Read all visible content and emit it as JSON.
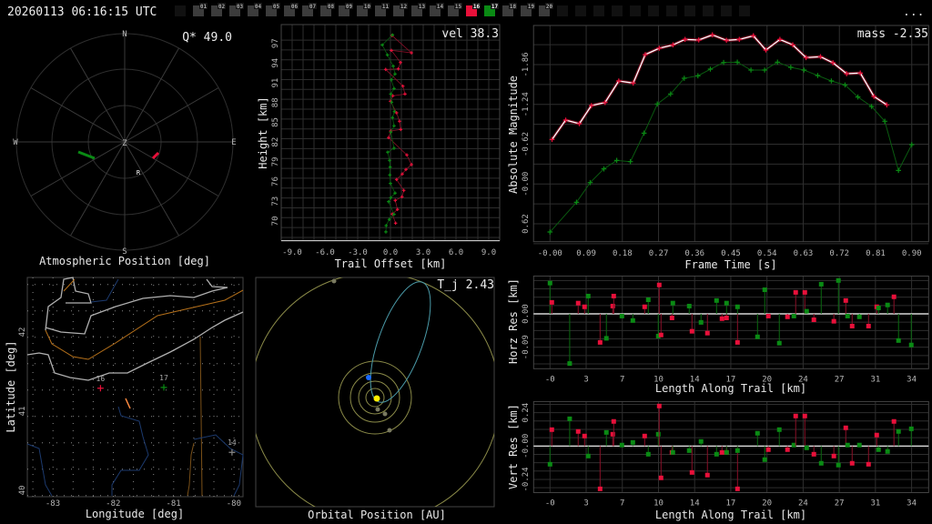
{
  "header": {
    "timestamp": "20260113 06:16:15 UTC",
    "menu_label": "...",
    "leading_empty_slots": 1,
    "trailing_empty_slots": 11,
    "stations": [
      {
        "label": "01",
        "state": "idle"
      },
      {
        "label": "02",
        "state": "idle"
      },
      {
        "label": "03",
        "state": "idle"
      },
      {
        "label": "04",
        "state": "idle"
      },
      {
        "label": "05",
        "state": "idle"
      },
      {
        "label": "06",
        "state": "idle"
      },
      {
        "label": "07",
        "state": "idle"
      },
      {
        "label": "08",
        "state": "idle"
      },
      {
        "label": "09",
        "state": "idle"
      },
      {
        "label": "10",
        "state": "idle"
      },
      {
        "label": "11",
        "state": "idle"
      },
      {
        "label": "12",
        "state": "idle"
      },
      {
        "label": "13",
        "state": "idle"
      },
      {
        "label": "14",
        "state": "idle"
      },
      {
        "label": "15",
        "state": "idle"
      },
      {
        "label": "16",
        "state": "red"
      },
      {
        "label": "17",
        "state": "green"
      },
      {
        "label": "18",
        "state": "idle"
      },
      {
        "label": "19",
        "state": "idle"
      },
      {
        "label": "20",
        "state": "idle"
      }
    ]
  },
  "colors": {
    "red": "#e8103a",
    "green": "#0a8a14",
    "idle": "#3c3c3c",
    "empty": "#111111",
    "bg": "#000000"
  },
  "polar": {
    "title": "Atmospheric Position [deg]",
    "stat": "Q* 49.0",
    "labels": {
      "n": "N",
      "s": "S",
      "e": "E",
      "w": "W",
      "z": "Z",
      "r": "R"
    }
  },
  "map": {
    "xlabel": "Longitude [deg]",
    "ylabel": "Latitude [deg]",
    "lon_ticks": [
      "-83",
      "-82",
      "-81",
      "-80"
    ],
    "lat_ticks": [
      "42",
      "41",
      "40"
    ],
    "stations": [
      {
        "label": "16",
        "lon": -82.21,
        "lat": 41.29,
        "color": "red"
      },
      {
        "label": "17",
        "lon": -81.16,
        "lat": 41.3,
        "color": "green"
      },
      {
        "label": "14",
        "lon": -80.03,
        "lat": 40.48,
        "color": "idle"
      }
    ]
  },
  "orbit": {
    "title": "Orbital Position [AU]",
    "stat": "T_j 2.43"
  },
  "chart_data": [
    {
      "type": "scatter",
      "name": "height-profile",
      "xlabel": "Trail Offset [km]",
      "ylabel": "Height [km]",
      "stat": "vel 38.3",
      "xlim": [
        -10,
        10
      ],
      "ylim": [
        67,
        100
      ],
      "xticks": [
        -9,
        -6,
        -3,
        0,
        3,
        6,
        9
      ],
      "xtick_labels": [
        "-9.0",
        "-6.0",
        "-3.0",
        "0.0",
        "3.0",
        "6.0",
        "9.0"
      ],
      "yticks": [
        70,
        73,
        76,
        79,
        82,
        85,
        88,
        91,
        94,
        97
      ],
      "ytick_labels": [
        "70",
        "73",
        "76",
        "79",
        "82",
        "85",
        "88",
        "91",
        "94",
        "97"
      ],
      "series": [
        {
          "name": "16",
          "color": "red",
          "x": [
            0.14,
            1.92,
            0.08,
            0.92,
            0.72,
            -0.44,
            1.14,
            1.33,
            0.22,
            0.0,
            0.56,
            0.83,
            0.94,
            0.03,
            -0.17,
            1.5,
            1.92,
            1.42,
            1.08,
            0.56,
            1.22,
            1.06,
            0.44,
            0.64,
            0.17,
            0.47
          ],
          "y": [
            98.2,
            95.57,
            95.94,
            94.1,
            93.13,
            93.04,
            90.5,
            89.3,
            89.03,
            88.2,
            86.45,
            85.16,
            83.91,
            83.68,
            82.67,
            80.04,
            78.57,
            77.83,
            77.14,
            76.31,
            74.65,
            73.68,
            73.13,
            71.75,
            71.06,
            69.67
          ]
        },
        {
          "name": "17",
          "color": "green",
          "x": [
            0.19,
            -0.75,
            -0.28,
            0.25,
            0.42,
            0.08,
            0.33,
            0.03,
            0.11,
            0.36,
            0.19,
            0.33,
            0.03,
            0.33,
            -0.25,
            -0.08,
            -0.03,
            -0.06,
            0.0,
            0.42,
            0.03,
            -0.17,
            0.33,
            -0.11,
            -0.39,
            -0.42
          ],
          "y": [
            98.29,
            96.77,
            95.25,
            93.54,
            92.35,
            91.47,
            90.13,
            89.3,
            88.06,
            86.63,
            85.71,
            84.47,
            83.5,
            81.06,
            80.46,
            79.21,
            78.2,
            77.0,
            75.71,
            74.24,
            73.54,
            72.94,
            71.01,
            70.23,
            69.3,
            68.34
          ]
        }
      ]
    },
    {
      "type": "line",
      "name": "light-curve",
      "xlabel": "Frame Time [s]",
      "ylabel": "Absolute Magnitude",
      "stat": "mass -2.35",
      "xlim": [
        -0.041,
        0.942
      ],
      "ylim": [
        -2.465,
        0.899
      ],
      "xticks": [
        0,
        0.09,
        0.18,
        0.27,
        0.36,
        0.45,
        0.54,
        0.63,
        0.72,
        0.81,
        0.9
      ],
      "xtick_labels": [
        "-0.00",
        "0.09",
        "0.18",
        "0.27",
        "0.36",
        "0.45",
        "0.54",
        "0.63",
        "0.72",
        "0.81",
        "0.90"
      ],
      "yticks": [
        -1.86,
        -1.24,
        -0.62,
        0,
        0.62
      ],
      "ytick_labels": [
        "-1.86",
        "-1.24",
        "-0.62",
        "-0.00",
        "0.62"
      ],
      "series": [
        {
          "name": "16",
          "color": "red",
          "x": [
            0.005,
            0.039,
            0.073,
            0.103,
            0.137,
            0.171,
            0.207,
            0.237,
            0.272,
            0.306,
            0.336,
            0.37,
            0.404,
            0.439,
            0.471,
            0.506,
            0.537,
            0.572,
            0.604,
            0.637,
            0.673,
            0.704,
            0.738,
            0.772,
            0.806,
            0.838
          ],
          "y": [
            -0.693,
            -0.995,
            -0.939,
            -1.222,
            -1.269,
            -1.605,
            -1.572,
            -2.016,
            -2.115,
            -2.167,
            -2.252,
            -2.243,
            -2.323,
            -2.238,
            -2.252,
            -2.309,
            -2.087,
            -2.252,
            -2.167,
            -1.969,
            -1.983,
            -1.888,
            -1.718,
            -1.728,
            -1.364,
            -1.232
          ]
        },
        {
          "name": "17",
          "color": "green",
          "x": [
            0.0,
            0.066,
            0.1,
            0.134,
            0.166,
            0.2,
            0.234,
            0.267,
            0.3,
            0.334,
            0.368,
            0.399,
            0.432,
            0.466,
            0.5,
            0.534,
            0.566,
            0.599,
            0.632,
            0.666,
            0.7,
            0.734,
            0.766,
            0.8,
            0.833,
            0.867,
            0.9
          ],
          "y": [
            0.748,
            0.285,
            -0.022,
            -0.235,
            -0.367,
            -0.348,
            -0.792,
            -1.246,
            -1.402,
            -1.647,
            -1.685,
            -1.789,
            -1.893,
            -1.898,
            -1.775,
            -1.775,
            -1.898,
            -1.817,
            -1.775,
            -1.69,
            -1.605,
            -1.543,
            -1.355,
            -1.208,
            -0.977,
            -0.211,
            -0.613
          ]
        }
      ]
    },
    {
      "type": "scatter",
      "name": "residuals",
      "xlabel": "Length Along Trail [km]",
      "horz_ylabel": "Horz Res [km]",
      "vert_ylabel": "Vert Res [km]",
      "xlim": [
        -1.54,
        35.6
      ],
      "horz_ylim": [
        -0.148,
        0.102
      ],
      "vert_ylim": [
        -0.335,
        0.32
      ],
      "xticks": [
        0,
        3.4,
        6.8,
        10.2,
        13.6,
        17,
        20.4,
        23.8,
        27.2,
        30.6,
        34
      ],
      "xtick_labels": [
        "-0",
        "3",
        "7",
        "10",
        "14",
        "17",
        "20",
        "24",
        "27",
        "31",
        "34"
      ],
      "horz_yticks": [
        0,
        -0.09
      ],
      "horz_ytick_labels": [
        "0.00",
        "-0.09"
      ],
      "vert_yticks": [
        0.24,
        0,
        -0.24
      ],
      "vert_ytick_labels": [
        "0.24",
        "-0.00",
        "-0.24"
      ],
      "points": [
        [
          "g",
          0.0,
          0.083,
          -0.131
        ],
        [
          "r",
          0.17,
          0.031,
          0.118
        ],
        [
          "g",
          1.85,
          -0.134,
          0.196
        ],
        [
          "r",
          2.65,
          0.029,
          0.105
        ],
        [
          "r",
          3.25,
          0.019,
          0.072
        ],
        [
          "g",
          3.59,
          0.048,
          -0.072
        ],
        [
          "r",
          4.71,
          -0.077,
          -0.308
        ],
        [
          "g",
          5.3,
          -0.066,
          0.098
        ],
        [
          "r",
          5.9,
          0.021,
          0.085
        ],
        [
          "r",
          5.99,
          0.048,
          0.177
        ],
        [
          "g",
          6.76,
          -0.006,
          0.007
        ],
        [
          "g",
          7.79,
          -0.018,
          0.026
        ],
        [
          "r",
          8.9,
          0.019,
          0.072
        ],
        [
          "g",
          9.24,
          0.038,
          -0.059
        ],
        [
          "g",
          10.18,
          -0.06,
          0.085
        ],
        [
          "r",
          10.27,
          0.078,
          0.288
        ],
        [
          "r",
          10.44,
          -0.057,
          -0.229
        ],
        [
          "r",
          11.47,
          -0.011,
          -0.046
        ],
        [
          "g",
          11.55,
          0.029,
          -0.046
        ],
        [
          "g",
          13.09,
          0.021,
          -0.033
        ],
        [
          "r",
          13.35,
          -0.047,
          -0.19
        ],
        [
          "g",
          14.2,
          -0.023,
          0.033
        ],
        [
          "r",
          14.8,
          -0.052,
          -0.209
        ],
        [
          "g",
          15.66,
          0.036,
          -0.059
        ],
        [
          "r",
          16.17,
          -0.013,
          -0.046
        ],
        [
          "r",
          16.6,
          -0.011,
          -0.046
        ],
        [
          "g",
          16.6,
          0.029,
          -0.046
        ],
        [
          "r",
          17.63,
          -0.077,
          -0.308
        ],
        [
          "g",
          17.63,
          0.019,
          -0.033
        ],
        [
          "g",
          19.51,
          -0.062,
          0.092
        ],
        [
          "g",
          20.19,
          0.065,
          -0.098
        ],
        [
          "r",
          20.53,
          -0.006,
          -0.026
        ],
        [
          "g",
          21.56,
          -0.079,
          0.118
        ],
        [
          "r",
          22.33,
          -0.008,
          -0.026
        ],
        [
          "g",
          22.93,
          -0.006,
          0.007
        ],
        [
          "r",
          23.1,
          0.058,
          0.216
        ],
        [
          "r",
          23.96,
          0.058,
          0.216
        ],
        [
          "g",
          24.13,
          0.007,
          -0.013
        ],
        [
          "r",
          24.81,
          -0.016,
          -0.059
        ],
        [
          "g",
          25.5,
          0.08,
          -0.124
        ],
        [
          "r",
          26.69,
          -0.02,
          -0.072
        ],
        [
          "g",
          27.12,
          0.09,
          -0.137
        ],
        [
          "r",
          27.81,
          0.036,
          0.131
        ],
        [
          "g",
          27.98,
          -0.006,
          0.007
        ],
        [
          "r",
          28.41,
          -0.033,
          -0.124
        ],
        [
          "g",
          29.09,
          -0.008,
          0.007
        ],
        [
          "r",
          29.95,
          -0.033,
          -0.131
        ],
        [
          "r",
          30.72,
          0.019,
          0.079
        ],
        [
          "g",
          30.89,
          0.016,
          -0.026
        ],
        [
          "g",
          31.74,
          0.024,
          -0.039
        ],
        [
          "r",
          32.34,
          0.046,
          0.177
        ],
        [
          "g",
          32.77,
          -0.072,
          0.105
        ],
        [
          "g",
          33.97,
          -0.084,
          0.124
        ]
      ]
    }
  ]
}
